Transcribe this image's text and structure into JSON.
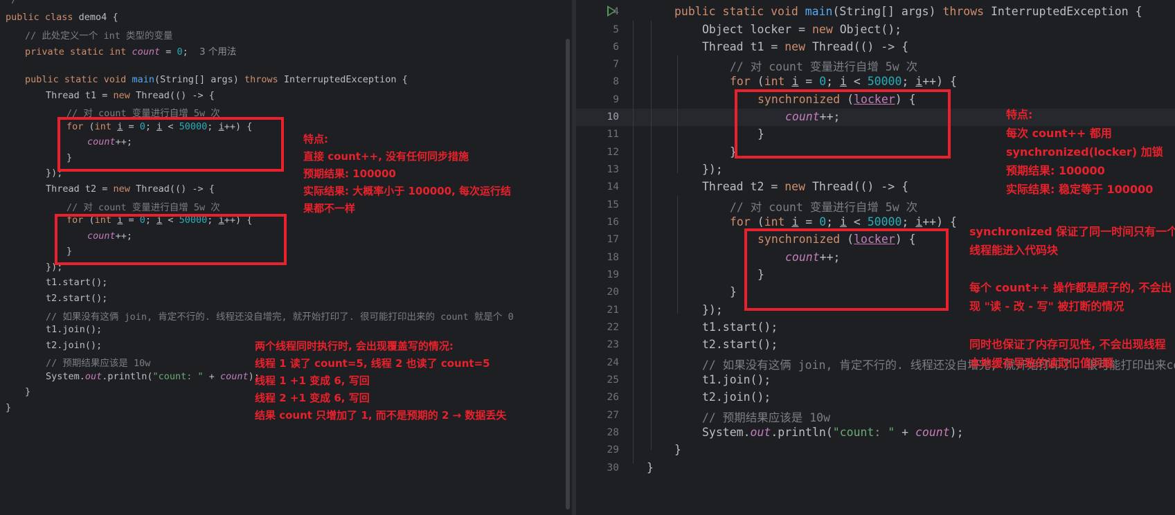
{
  "left_editor": {
    "top_fragment": "*/",
    "lines": [
      "public class demo4 {",
      "// 此处定义一个 int 类型的变量",
      "private static int count = 0;",
      "",
      "public static void main(String[] args) throws InterruptedException {",
      "Thread t1 = new Thread(() -> {",
      "// 对 count 变量进行自增 5w 次",
      "for (int i = 0; i < 50000; i++) {",
      "count++;",
      "}",
      "});",
      "Thread t2 = new Thread(() -> {",
      "// 对 count 变量进行自增 5w 次",
      "for (int i = 0; i < 50000; i++) {",
      "count++;",
      "}",
      "});",
      "t1.start();",
      "t2.start();",
      "// 如果没有这俩 join, 肯定不行的. 线程还没自增完, 就开始打印了. 很可能打印出来的 count 就是个 0",
      "t1.join();",
      "t2.join();",
      "// 预期结果应该是 10w",
      "System.out.println(\"count: \" + count);",
      "}",
      "}"
    ],
    "usage_hint": "3 个用法",
    "note_features": [
      "特点:",
      "直接 count++, 没有任何同步措施",
      "预期结果: 100000",
      "实际结果: 大概率小于 100000, 每次运行结",
      "果都不一样"
    ],
    "note_race": [
      "两个线程同时执行时, 会出现覆盖写的情况:",
      "线程 1 读了 count=5, 线程 2 也读了 count=5",
      "线程 1 +1 变成 6, 写回",
      "线程 2 +1 变成 6, 写回",
      "结果 count 只增加了 1, 而不是预期的 2 → 数据丢失"
    ]
  },
  "right_editor": {
    "line_numbers": [
      "4",
      "5",
      "6",
      "7",
      "8",
      "9",
      "10",
      "11",
      "12",
      "13",
      "14",
      "15",
      "16",
      "17",
      "18",
      "19",
      "20",
      "21",
      "22",
      "23",
      "24",
      "25",
      "26",
      "27",
      "28",
      "29",
      "30"
    ],
    "current_line": "10",
    "lines": [
      "public static void main(String[] args) throws InterruptedException {",
      "Object locker = new Object();",
      "Thread t1 = new Thread(() -> {",
      "// 对 count 变量进行自增 5w 次",
      "for (int i = 0; i < 50000; i++) {",
      "synchronized (locker) {",
      "count++;",
      "}",
      "}",
      "});",
      "Thread t2 = new Thread(() -> {",
      "// 对 count 变量进行自增 5w 次",
      "for (int i = 0; i < 50000; i++) {",
      "synchronized (locker) {",
      "count++;",
      "}",
      "}",
      "});",
      "t1.start();",
      "t2.start();",
      "// 如果没有这俩 join, 肯定不行的. 线程还没自增完, 就开始打印了. 很可能打印出来co",
      "t1.join();",
      "t2.join();",
      "// 预期结果应该是 10w",
      "System.out.println(\"count: \" + count);",
      "}",
      "}"
    ],
    "note_features": [
      "特点:",
      "每次 count++ 都用",
      "synchronized(locker) 加锁",
      "预期结果: 100000",
      "实际结果: 稳定等于 100000"
    ],
    "note_sync": [
      "synchronized 保证了同一时间只有一个",
      "线程能进入代码块"
    ],
    "note_atomic": [
      "每个 count++ 操作都是原子的, 不会出",
      "现 \"读 - 改 - 写\" 被打断的情况"
    ],
    "note_visibility": [
      "同时也保证了内存可见性, 不会出现线程",
      "本地缓存导致的读取旧值问题"
    ]
  },
  "colors": {
    "background": "#1e1f22",
    "keyword": "#cf8e6d",
    "number": "#2aacb8",
    "string": "#6aab73",
    "comment": "#7a7e85",
    "field": "#c77dbb",
    "method": "#56a8f5",
    "annotation_red": "#e8222c"
  },
  "icons": [
    "run-gutter-icon"
  ]
}
